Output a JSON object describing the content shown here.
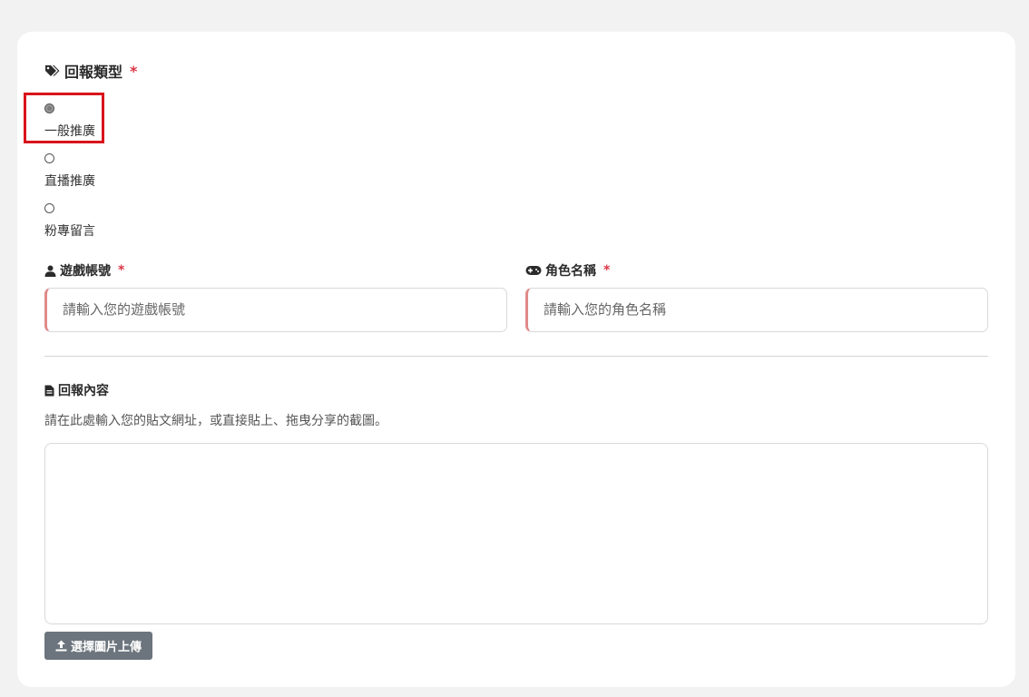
{
  "report_type": {
    "title": "回報類型",
    "required_mark": "*",
    "options": [
      {
        "label": "一般推廣",
        "checked": true
      },
      {
        "label": "直播推廣",
        "checked": false
      },
      {
        "label": "粉專留言",
        "checked": false
      }
    ]
  },
  "account": {
    "label": "遊戲帳號",
    "required_mark": "*",
    "placeholder": "請輸入您的遊戲帳號"
  },
  "character": {
    "label": "角色名稱",
    "required_mark": "*",
    "placeholder": "請輸入您的角色名稱"
  },
  "content": {
    "title": "回報內容",
    "description": "請在此處輸入您的貼文網址，或直接貼上、拖曳分享的截圖。"
  },
  "upload": {
    "label": "選擇圖片上傳"
  },
  "icons": {
    "report_type": "tags-icon",
    "account": "user-icon",
    "character": "gamepad-icon",
    "content": "file-icon",
    "upload": "upload-icon"
  },
  "colors": {
    "required": "#dc3545",
    "highlight": "#d9141b",
    "input_accent": "#e08a8a",
    "button": "#6c757d"
  }
}
